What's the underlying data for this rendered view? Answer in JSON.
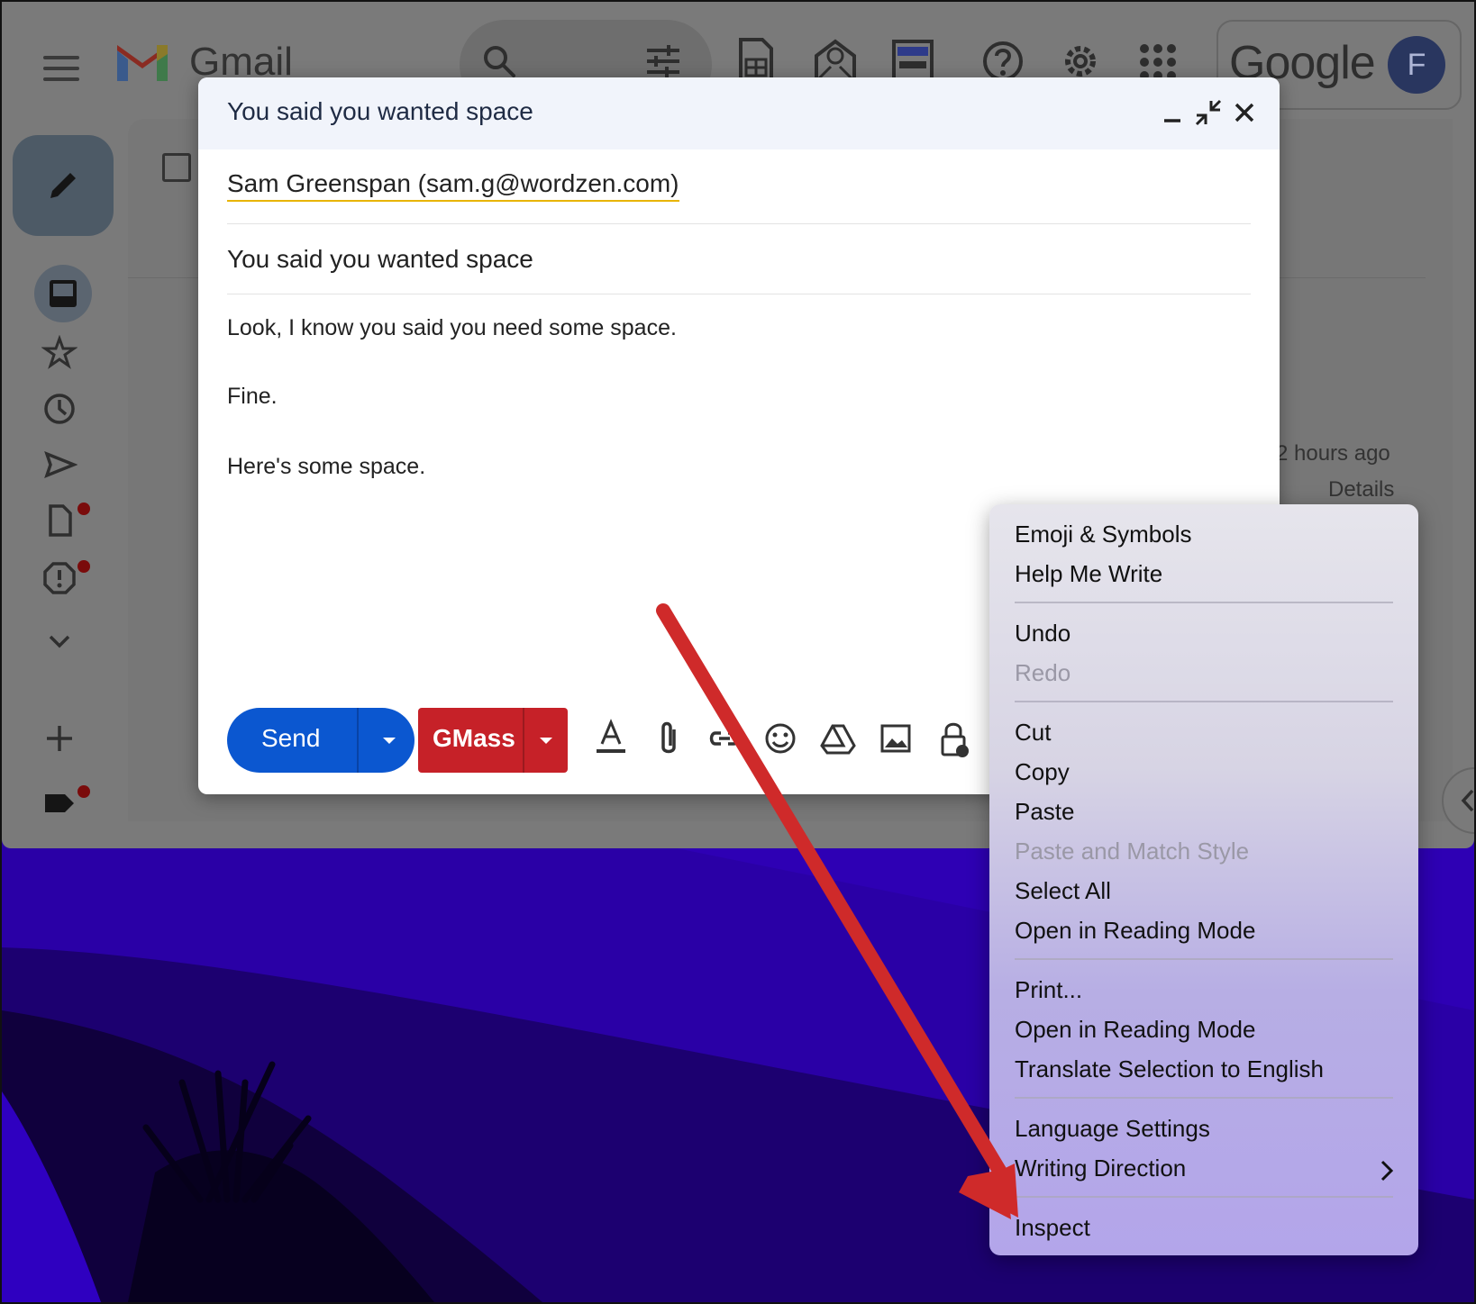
{
  "gmail": {
    "logo_text": "Gmail",
    "brand_text": "Google",
    "avatar_letter": "F",
    "list_time": "2 hours ago",
    "list_details": "Details"
  },
  "compose": {
    "window_title": "You said you wanted space",
    "recipient": "Sam Greenspan (sam.g@wordzen.com)",
    "subject": "You said you wanted space",
    "body": [
      "Look, I know you said you need some space.",
      "Fine.",
      "Here's some space."
    ],
    "send_label": "Send",
    "gmass_label": "GMass"
  },
  "context_menu": {
    "items": [
      {
        "label": "Emoji & Symbols",
        "enabled": true
      },
      {
        "label": "Help Me Write",
        "enabled": true
      },
      {
        "label": "Undo",
        "enabled": true
      },
      {
        "label": "Redo",
        "enabled": false
      },
      {
        "label": "Cut",
        "enabled": true
      },
      {
        "label": "Copy",
        "enabled": true
      },
      {
        "label": "Paste",
        "enabled": true
      },
      {
        "label": "Paste and Match Style",
        "enabled": false
      },
      {
        "label": "Select All",
        "enabled": true
      },
      {
        "label": "Open in Reading Mode",
        "enabled": true
      },
      {
        "label": "Print...",
        "enabled": true
      },
      {
        "label": "Open in Reading Mode",
        "enabled": true
      },
      {
        "label": "Translate Selection to English",
        "enabled": true
      },
      {
        "label": "Language Settings",
        "enabled": true
      },
      {
        "label": "Writing Direction",
        "enabled": true,
        "submenu": true
      },
      {
        "label": "Inspect",
        "enabled": true
      }
    ]
  },
  "colors": {
    "send_blue": "#0b57d0",
    "gmass_red": "#c62128",
    "annotation_arrow": "#cf2a2a",
    "wallpaper": "#3100b8"
  }
}
